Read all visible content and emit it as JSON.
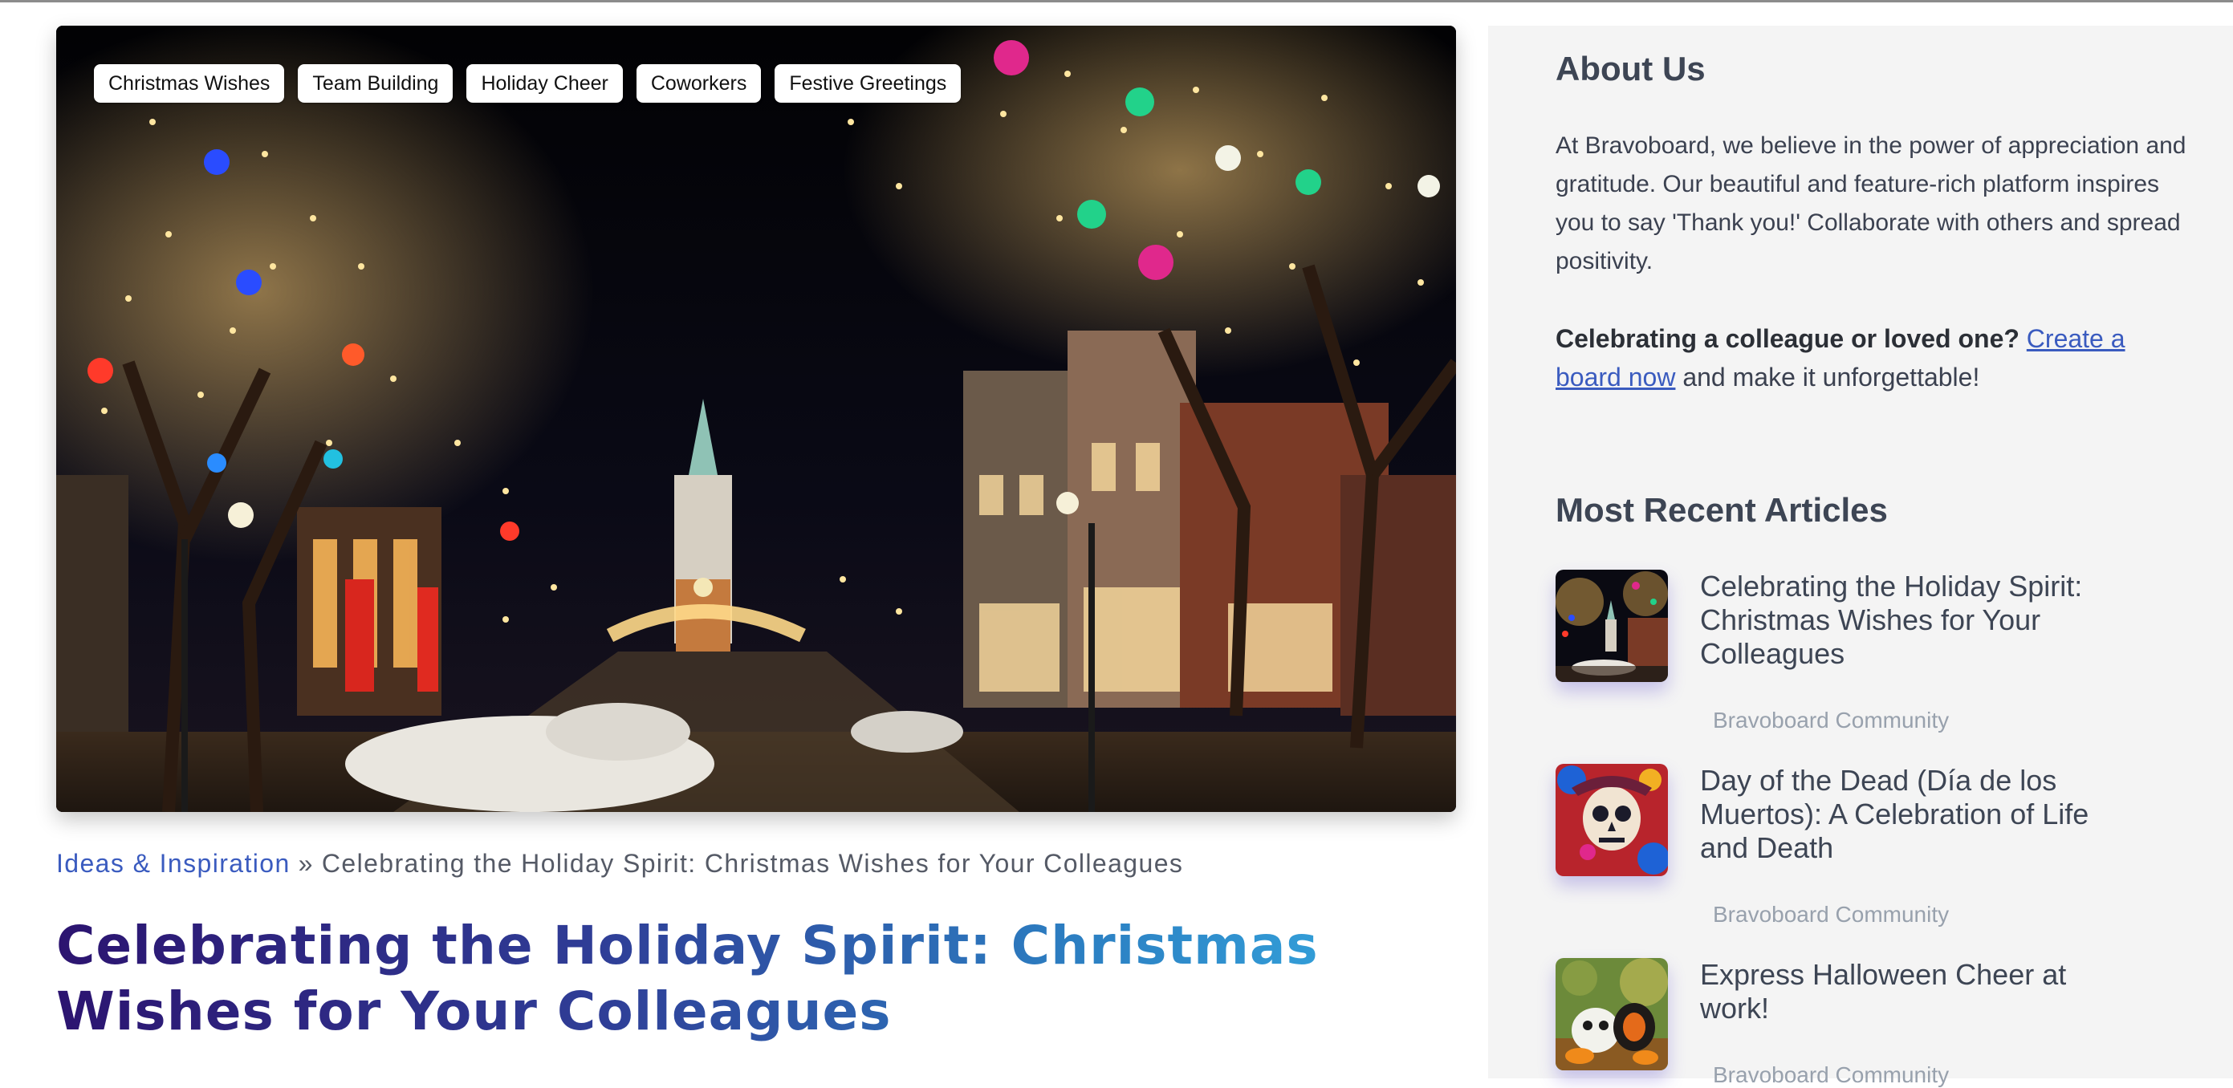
{
  "hero": {
    "tags": [
      "Christmas Wishes",
      "Team Building",
      "Holiday Cheer",
      "Coworkers",
      "Festive Greetings"
    ]
  },
  "breadcrumb": {
    "parent": "Ideas & Inspiration",
    "separator": "»",
    "current": "Celebrating the Holiday Spirit: Christmas Wishes for Your Colleagues"
  },
  "article": {
    "title": "Celebrating the Holiday Spirit: Christmas Wishes for Your Colleagues"
  },
  "sidebar": {
    "about": {
      "heading": "About Us",
      "text": "At Bravoboard, we believe in the power of appreciation and gratitude. Our beautiful and feature-rich platform inspires you to say 'Thank you!' Collaborate with others and spread positivity.",
      "cta_bold": "Celebrating a colleague or loved one?",
      "cta_link": "Create a board now",
      "cta_rest": "and make it unforgettable!"
    },
    "recent": {
      "heading": "Most Recent Articles",
      "items": [
        {
          "title": "Celebrating the Holiday Spirit: Christmas Wishes for Your Colleagues",
          "source": "Bravoboard Community",
          "thumb": "christmas-street-thumbnail"
        },
        {
          "title": "Day of the Dead (Día de los Muertos): A Celebration of Life and Death",
          "source": "Bravoboard Community",
          "thumb": "sugar-skull-thumbnail"
        },
        {
          "title": "Express Halloween Cheer at work!",
          "source": "Bravoboard Community",
          "thumb": "halloween-pumpkins-thumbnail"
        }
      ]
    }
  },
  "colors": {
    "link": "#3a5bbf",
    "title_gradient_start": "#2c1470",
    "title_gradient_end": "#35a9e0",
    "sidebar_bg": "#f4f4f4",
    "muted": "#98a1ad"
  }
}
